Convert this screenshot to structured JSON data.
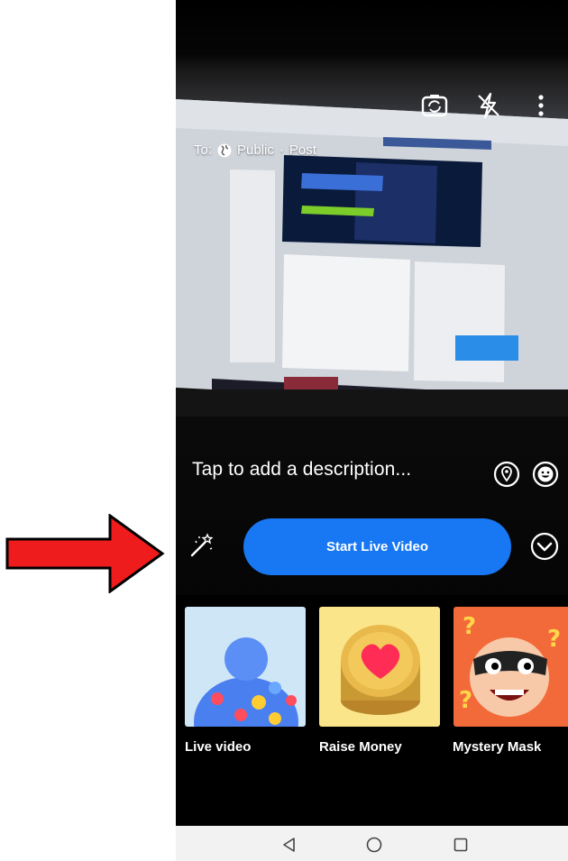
{
  "camera_overlay": {
    "audience_prefix": "To:",
    "audience_value": "Public",
    "post_label": "Post",
    "description_placeholder": "Tap to add a description...",
    "icons": [
      "camera-flip-icon",
      "flash-off-icon",
      "more-options-icon",
      "location-icon",
      "emoji-icon",
      "magic-wand-icon",
      "chevron-down-circle-icon"
    ]
  },
  "primary_action": {
    "label": "Start Live Video",
    "color": "#1877f2"
  },
  "formats": [
    {
      "label": "Live video",
      "icon": "live-video-tile"
    },
    {
      "label": "Raise Money",
      "icon": "raise-money-tile"
    },
    {
      "label": "Mystery Mask",
      "icon": "mystery-mask-tile"
    }
  ],
  "nav_bar": {
    "icons": [
      "back-triangle-icon",
      "home-circle-icon",
      "recents-square-icon"
    ]
  },
  "annotation": {
    "arrow_color": "#e8141b"
  }
}
